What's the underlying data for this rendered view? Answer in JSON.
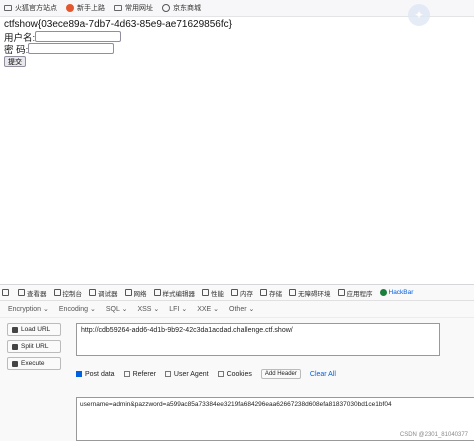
{
  "bookmarks": [
    {
      "label": "火狐官方站点",
      "icon": "folder-icon"
    },
    {
      "label": "新手上路",
      "icon": "firefox-icon"
    },
    {
      "label": "常用网址",
      "icon": "folder-icon"
    },
    {
      "label": "京东商城",
      "icon": "globe-icon"
    }
  ],
  "page": {
    "title": "ctfshow{03ece89a-7db7-4d63-85e9-ae71629856fc}",
    "username_label": "用户名:",
    "password_label": "密  码:",
    "submit_label": "提交"
  },
  "devtools_tabs": [
    {
      "label": "查看器"
    },
    {
      "label": "控制台"
    },
    {
      "label": "调试器"
    },
    {
      "label": "网络"
    },
    {
      "label": "样式编辑器"
    },
    {
      "label": "性能"
    },
    {
      "label": "内存"
    },
    {
      "label": "存储"
    },
    {
      "label": "无障碍环境"
    },
    {
      "label": "应用程序"
    },
    {
      "label": "HackBar"
    }
  ],
  "hackbar": {
    "menu": [
      "Encryption ⌄",
      "Encoding ⌄",
      "SQL ⌄",
      "XSS ⌄",
      "LFI ⌄",
      "XXE ⌄",
      "Other ⌄"
    ],
    "load_url": "Load URL",
    "split_url": "Split URL",
    "execute": "Execute",
    "url_value": "http://cdb59264-add6-4d1b-9b92-42c3da1acdad.challenge.ctf.show/",
    "post_data_label": "Post data",
    "referer_label": "Referer",
    "user_agent_label": "User Agent",
    "cookies_label": "Cookies",
    "add_header": "Add Header",
    "clear_all": "Clear All",
    "post_body": "username=admin&pazzword=a599ac85a73384ee3219fa684296eaa62667238d608efa81837030bd1ce1bf04"
  },
  "watermark": "CSDN @2301_81040377"
}
